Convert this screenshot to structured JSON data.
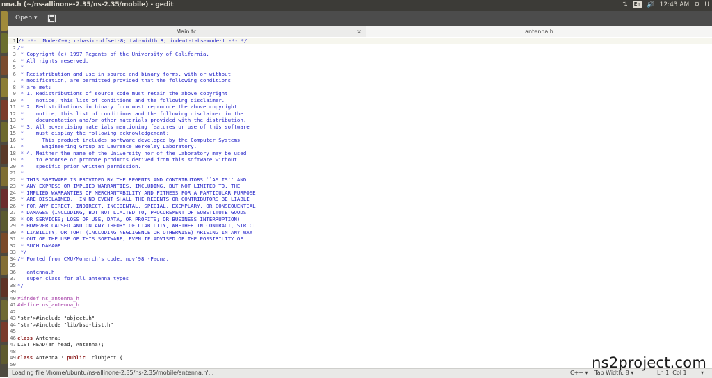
{
  "window": {
    "title": "nna.h (~/ns-allinone-2.35/ns-2.35/mobile) - gedit"
  },
  "tray": {
    "keyboard": "En",
    "volume_icon": "speaker-icon",
    "clock": "12:43 AM",
    "user": "U"
  },
  "toolbar": {
    "open_label": "Open",
    "open_arrow": "▾",
    "save_icon": "save-icon"
  },
  "tabs": [
    {
      "label": "Main.tcl",
      "close": "×"
    },
    {
      "label": "antenna.h"
    }
  ],
  "lines": [
    {
      "n": "1",
      "t": "/* -*-  Mode:C++; c-basic-offset:8; tab-width:8; indent-tabs-mode:t -*- */"
    },
    {
      "n": "2",
      "t": "/*"
    },
    {
      "n": "3",
      "t": " * Copyright (c) 1997 Regents of the University of California."
    },
    {
      "n": "4",
      "t": " * All rights reserved."
    },
    {
      "n": "5",
      "t": " *"
    },
    {
      "n": "6",
      "t": " * Redistribution and use in source and binary forms, with or without"
    },
    {
      "n": "7",
      "t": " * modification, are permitted provided that the following conditions"
    },
    {
      "n": "8",
      "t": " * are met:"
    },
    {
      "n": "9",
      "t": " * 1. Redistributions of source code must retain the above copyright"
    },
    {
      "n": "10",
      "t": " *    notice, this list of conditions and the following disclaimer."
    },
    {
      "n": "11",
      "t": " * 2. Redistributions in binary form must reproduce the above copyright"
    },
    {
      "n": "12",
      "t": " *    notice, this list of conditions and the following disclaimer in the"
    },
    {
      "n": "13",
      "t": " *    documentation and/or other materials provided with the distribution."
    },
    {
      "n": "14",
      "t": " * 3. All advertising materials mentioning features or use of this software"
    },
    {
      "n": "15",
      "t": " *    must display the following acknowledgement:"
    },
    {
      "n": "16",
      "t": " *      This product includes software developed by the Computer Systems"
    },
    {
      "n": "17",
      "t": " *      Engineering Group at Lawrence Berkeley Laboratory."
    },
    {
      "n": "18",
      "t": " * 4. Neither the name of the University nor of the Laboratory may be used"
    },
    {
      "n": "19",
      "t": " *    to endorse or promote products derived from this software without"
    },
    {
      "n": "20",
      "t": " *    specific prior written permission."
    },
    {
      "n": "21",
      "t": " *"
    },
    {
      "n": "22",
      "t": " * THIS SOFTWARE IS PROVIDED BY THE REGENTS AND CONTRIBUTORS ``AS IS'' AND"
    },
    {
      "n": "23",
      "t": " * ANY EXPRESS OR IMPLIED WARRANTIES, INCLUDING, BUT NOT LIMITED TO, THE"
    },
    {
      "n": "24",
      "t": " * IMPLIED WARRANTIES OF MERCHANTABILITY AND FITNESS FOR A PARTICULAR PURPOSE"
    },
    {
      "n": "25",
      "t": " * ARE DISCLAIMED.  IN NO EVENT SHALL THE REGENTS OR CONTRIBUTORS BE LIABLE"
    },
    {
      "n": "26",
      "t": " * FOR ANY DIRECT, INDIRECT, INCIDENTAL, SPECIAL, EXEMPLARY, OR CONSEQUENTIAL"
    },
    {
      "n": "27",
      "t": " * DAMAGES (INCLUDING, BUT NOT LIMITED TO, PROCUREMENT OF SUBSTITUTE GOODS"
    },
    {
      "n": "28",
      "t": " * OR SERVICES; LOSS OF USE, DATA, OR PROFITS; OR BUSINESS INTERRUPTION)"
    },
    {
      "n": "29",
      "t": " * HOWEVER CAUSED AND ON ANY THEORY OF LIABILITY, WHETHER IN CONTRACT, STRICT"
    },
    {
      "n": "30",
      "t": " * LIABILITY, OR TORT (INCLUDING NEGLIGENCE OR OTHERWISE) ARISING IN ANY WAY"
    },
    {
      "n": "31",
      "t": " * OUT OF THE USE OF THIS SOFTWARE, EVEN IF ADVISED OF THE POSSIBILITY OF"
    },
    {
      "n": "32",
      "t": " * SUCH DAMAGE."
    },
    {
      "n": "33",
      "t": " */"
    },
    {
      "n": "34",
      "t": "/* Ported from CMU/Monarch's code, nov'98 -Padma."
    },
    {
      "n": "35",
      "t": ""
    },
    {
      "n": "36",
      "t": "   antenna.h"
    },
    {
      "n": "37",
      "t": "   super class for all antenna types"
    },
    {
      "n": "38",
      "t": "*/"
    },
    {
      "n": "39",
      "t": ""
    },
    {
      "n": "40",
      "t": "#ifndef ns_antenna_h"
    },
    {
      "n": "41",
      "t": "#define ns_antenna_h"
    },
    {
      "n": "42",
      "t": ""
    },
    {
      "n": "43",
      "t": "#include \"object.h\""
    },
    {
      "n": "44",
      "t": "#include \"lib/bsd-list.h\""
    },
    {
      "n": "45",
      "t": ""
    },
    {
      "n": "46",
      "t": "class Antenna;"
    },
    {
      "n": "47",
      "t": "LIST_HEAD(an_head, Antenna);"
    },
    {
      "n": "48",
      "t": ""
    },
    {
      "n": "49",
      "t": "class Antenna : public TclObject {"
    },
    {
      "n": "50",
      "t": ""
    }
  ],
  "status": {
    "message": "Loading file '/home/ubuntu/ns-allinone-2.35/ns-2.35/mobile/antenna.h'...",
    "language": "C++ ▾",
    "tab_width": "Tab Width: 8 ▾",
    "position": "Ln 1, Col 1",
    "mode": "▾"
  },
  "watermark": "ns2project.com",
  "colors": {
    "comment": "#2323c8",
    "preprocessor": "#a43ba5",
    "keyword": "#8b1a1a",
    "topbar": "#3c3b37"
  }
}
